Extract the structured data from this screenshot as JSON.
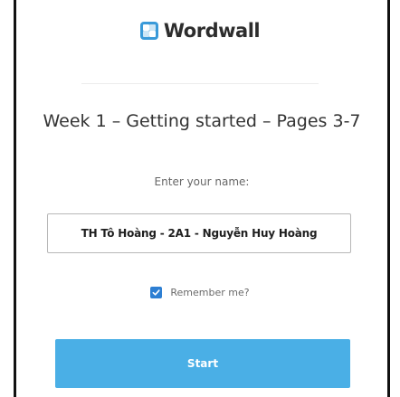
{
  "brand": {
    "name": "Wordwall",
    "icon": "wordwall-logo-icon",
    "color": "#3a9ad9"
  },
  "activity": {
    "title": "Week 1 – Getting started – Pages 3-7"
  },
  "form": {
    "prompt": "Enter your name:",
    "name_value": "TH Tô Hoàng - 2A1 - Nguyễn Huy Hoàng",
    "remember_label": "Remember me?",
    "remember_checked": true,
    "checkbox_color": "#2d7fd3",
    "start_label": "Start",
    "start_color": "#4aafe6"
  }
}
